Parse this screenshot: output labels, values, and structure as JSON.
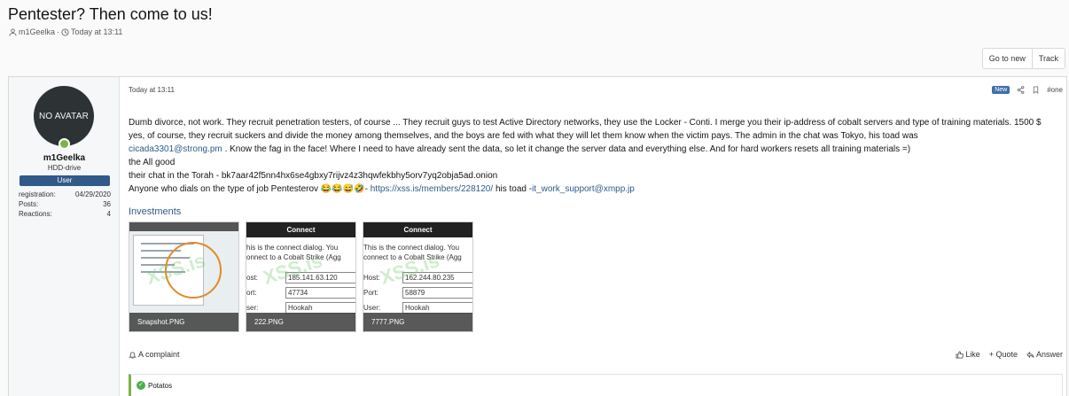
{
  "thread": {
    "title": "Pentester? Then come to us!",
    "author": "m1Geelka",
    "separator": "·",
    "time": "Today at 13:11"
  },
  "top_actions": {
    "go_to_new": "Go to new",
    "track": "Track"
  },
  "user": {
    "avatar_text": "NO AVATAR",
    "name": "m1Geelka",
    "title": "HDD-drive",
    "banner": "User",
    "stats": [
      {
        "label": "registration:",
        "value": "04/29/2020"
      },
      {
        "label": "Posts:",
        "value": "36"
      },
      {
        "label": "Reactions:",
        "value": "4"
      }
    ]
  },
  "post": {
    "date": "Today at 13:11",
    "badge": "New",
    "number": "#one",
    "paragraph1_a": "Dumb divorce, not work. They recruit penetration testers, of course ... They recruit guys to test Active Directory networks, they use the Locker - Conti. I merge you their ip-address of cobalt servers and type of training materials. 1500 $ yes, of course, they recruit suckers and divide the money among themselves, and the boys are fed with what they will let them know when the victim pays. The admin in the chat was Tokyo, his toad was",
    "email1": "cicada3301@strong.pm",
    "paragraph1_b": ". Know the fag in the face! Where I need to have already sent the data, so let it change the server data and everything else. And for hard workers resets all training materials =)",
    "line2": "the All good",
    "line3": "their chat in the Torah - bk7aar42f5nn4hx6se4gbxy7rijvz4z3hqwfekbhy5orv7yq2obja5ad.onion",
    "line4_a": "Anyone who dials on the type of job Pentesterov",
    "emojis": "😂😂😅🤣",
    "line4_b": "-",
    "link": "https://xss.is/members/228120/",
    "line4_c": "his toad -",
    "email2": "it_work_support@xmpp.jp",
    "attachments_title": "Investments",
    "attachments": [
      {
        "label": "Snapshot.PNG"
      },
      {
        "label": "222.PNG",
        "header": "Connect",
        "text1": "his is the connect dialog. You",
        "text2": "onnect to a Cobalt Strike (Agg",
        "host_label": "ost:",
        "host": "185.141.63.120",
        "port_label": "ort:",
        "port": "47734",
        "user_label": "ser:",
        "user": "Hookah"
      },
      {
        "label": "7777.PNG",
        "header": "Connect",
        "text1": "This is the connect dialog. You",
        "text2": "connect to a Cobalt Strike (Agg",
        "host_label": "Host:",
        "host": "162.244.80.235",
        "port_label": "Port:",
        "port": "58879",
        "user_label": "User:",
        "user": "Hookah"
      }
    ],
    "watermark": "XSS.is"
  },
  "footer": {
    "complaint": "A complaint",
    "like": "Like",
    "quote": "+ Quote",
    "answer": "Answer"
  },
  "reactions": {
    "icon_text": "✓",
    "text": "Potatos"
  }
}
